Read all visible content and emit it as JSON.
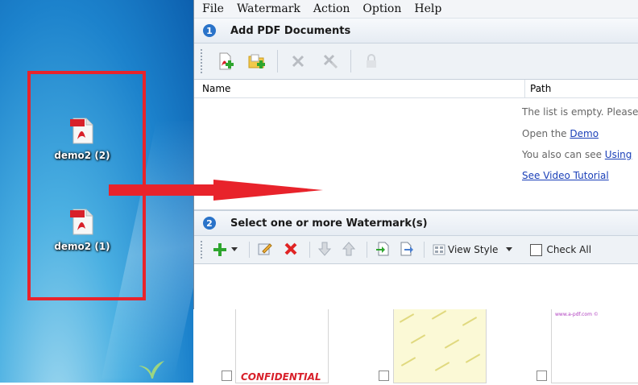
{
  "desktop": {
    "icons": [
      {
        "label": "demo2 (2)",
        "file_tag": "PDF",
        "file_sub": "Adobe"
      },
      {
        "label": "demo2 (1)",
        "file_tag": "PDF",
        "file_sub": "Adobe"
      }
    ]
  },
  "menu": [
    {
      "label": "File"
    },
    {
      "label": "Watermark"
    },
    {
      "label": "Action"
    },
    {
      "label": "Option"
    },
    {
      "label": "Help"
    }
  ],
  "section1": {
    "step": "1",
    "title": "Add PDF Documents"
  },
  "list": {
    "col_name": "Name",
    "col_path": "Path",
    "empty_text": "The list is empty. Please",
    "open_text": "Open the ",
    "demo_link": "Demo",
    "also_text": "You also can see ",
    "using_link": "Using",
    "video_link": "See Video Tutorial"
  },
  "section2": {
    "step": "2",
    "title": "Select one or more Watermark(s)"
  },
  "wm_toolbar": {
    "view_style": "View Style",
    "check_all": "Check All"
  },
  "thumbs": [
    {
      "text": "CONFIDENTIAL"
    },
    {
      "text": ""
    },
    {
      "text": "www.a-pdf.com ©"
    }
  ],
  "colors": {
    "highlight_red": "#e8232b",
    "accent_blue": "#2a73c9"
  }
}
